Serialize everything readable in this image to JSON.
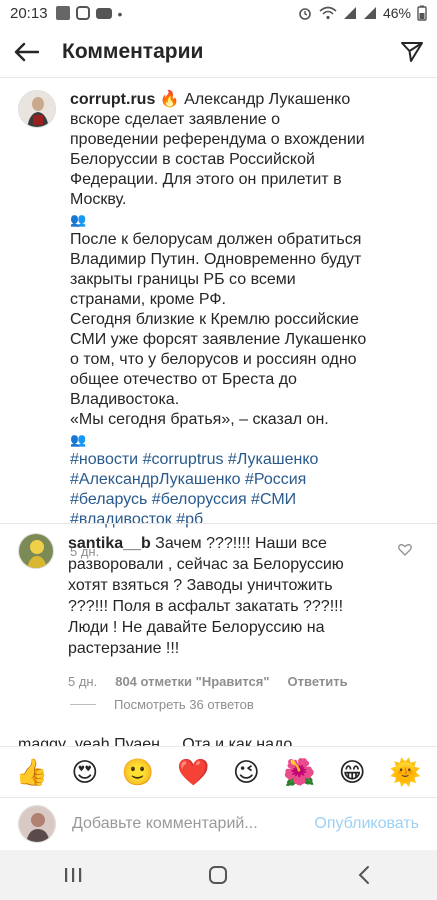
{
  "status_bar": {
    "time": "20:13",
    "battery": "46%"
  },
  "header": {
    "title": "Комментарии",
    "back_icon": "arrow-left-icon",
    "send_icon": "paper-plane-icon"
  },
  "caption": {
    "username": "corrupt.rus",
    "fire_emoji": "🔥",
    "line1": "Александр Лукашенко вскоре сделает заявление о проведении референдума о вхождении Белоруссии в состав Российской Федерации. Для этого он прилетит в Москву.",
    "people_emoji": "👥",
    "line2": "После к белорусам должен обратиться Владимир Путин. Одновременно будут закрыты границы РБ со всеми странами, кроме РФ.",
    "line3": "Сегодня близкие к Кремлю российские СМИ уже форсят заявление Лукашенко о том, что у белорусов и россиян одно общее отечество от Бреста до Владивостока.",
    "line4": "«Мы сегодня братья», – сказал он.",
    "hashtags": "#новости #corruptrus #Лукашенко #АлександрЛукашенко #Россия #беларусь #белоруссия #СМИ #владивосток #рб",
    "time_ago": "5 дн."
  },
  "comment": {
    "username": "santika__b",
    "text": "Зачем ???!!!! Наши все разворовали , сейчас за Белоруссию хотят взяться ? Заводы уничтожить ???!!! Поля в асфальт закатать ???!!! Люди ! Не давайте Белоруссию на растерзание !!!",
    "time_ago": "5 дн.",
    "likes": "804 отметки \"Нравится\"",
    "reply": "Ответить",
    "heart_icon": "heart-outline-icon"
  },
  "view_replies": "Посмотреть 36 ответов",
  "next_comment_partial": "maggy_yeah Пуаен ... Ота и как надо",
  "emoji_bar": [
    "👍",
    "😍",
    "🙂",
    "❤️",
    "😉",
    "🌺",
    "😁",
    "🌞"
  ],
  "input": {
    "placeholder": "Добавьте комментарий...",
    "publish": "Опубликовать"
  },
  "colors": {
    "hashtag": "#2a5a8c",
    "publish_disabled": "#9dd1f5",
    "meta": "#8e8e8e"
  }
}
